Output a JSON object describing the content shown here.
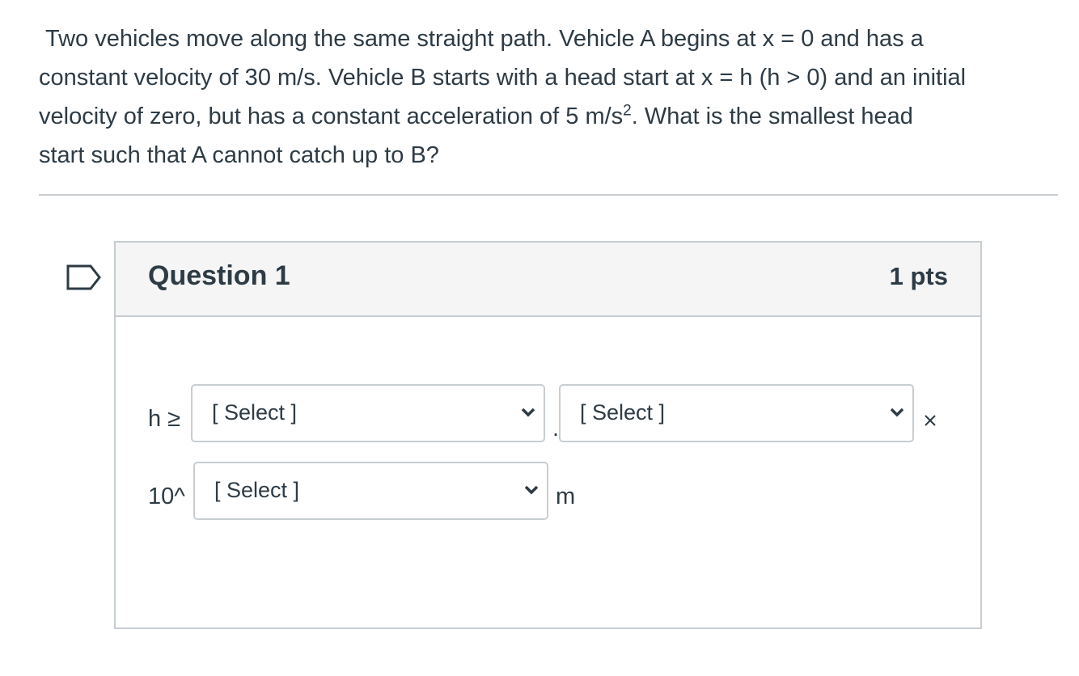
{
  "problem": {
    "line1": "Two vehicles move along the same straight path.  Vehicle A begins at x = 0 and has a",
    "line2": "constant velocity of 30 m/s. Vehicle B starts with a head start at x = h (h > 0) and an initial",
    "line3_pre": "velocity of zero, but has a constant acceleration of 5 m/s",
    "line3_sup": "2",
    "line3_post": ".  What is the smallest head",
    "line4": "start such that A cannot catch up to B?"
  },
  "question": {
    "title": "Question 1",
    "points": "1 pts",
    "answer": {
      "h_label": "h ≥",
      "select1": "[ Select ]",
      "decimal": ".",
      "select2": "[ Select ]",
      "times": "×",
      "exp_label": "10^",
      "select3": "[ Select ]",
      "unit": "m"
    }
  },
  "icons": {
    "flag": "flag-bookmark-icon",
    "chevron": "chevron-down-icon",
    "times": "multiply-sign-icon"
  },
  "colors": {
    "text": "#2d3b45",
    "border": "#c7cdd1",
    "header_bg": "#f5f5f5",
    "flag": "#2d3b45"
  }
}
